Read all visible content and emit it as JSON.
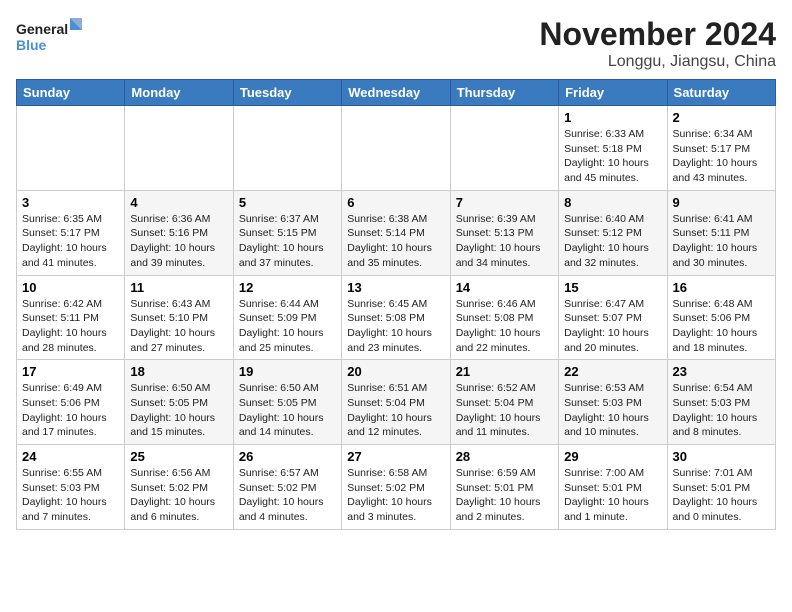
{
  "logo": {
    "line1": "General",
    "line2": "Blue"
  },
  "title": "November 2024",
  "location": "Longgu, Jiangsu, China",
  "days_header": [
    "Sunday",
    "Monday",
    "Tuesday",
    "Wednesday",
    "Thursday",
    "Friday",
    "Saturday"
  ],
  "weeks": [
    [
      {
        "day": "",
        "info": ""
      },
      {
        "day": "",
        "info": ""
      },
      {
        "day": "",
        "info": ""
      },
      {
        "day": "",
        "info": ""
      },
      {
        "day": "",
        "info": ""
      },
      {
        "day": "1",
        "info": "Sunrise: 6:33 AM\nSunset: 5:18 PM\nDaylight: 10 hours\nand 45 minutes."
      },
      {
        "day": "2",
        "info": "Sunrise: 6:34 AM\nSunset: 5:17 PM\nDaylight: 10 hours\nand 43 minutes."
      }
    ],
    [
      {
        "day": "3",
        "info": "Sunrise: 6:35 AM\nSunset: 5:17 PM\nDaylight: 10 hours\nand 41 minutes."
      },
      {
        "day": "4",
        "info": "Sunrise: 6:36 AM\nSunset: 5:16 PM\nDaylight: 10 hours\nand 39 minutes."
      },
      {
        "day": "5",
        "info": "Sunrise: 6:37 AM\nSunset: 5:15 PM\nDaylight: 10 hours\nand 37 minutes."
      },
      {
        "day": "6",
        "info": "Sunrise: 6:38 AM\nSunset: 5:14 PM\nDaylight: 10 hours\nand 35 minutes."
      },
      {
        "day": "7",
        "info": "Sunrise: 6:39 AM\nSunset: 5:13 PM\nDaylight: 10 hours\nand 34 minutes."
      },
      {
        "day": "8",
        "info": "Sunrise: 6:40 AM\nSunset: 5:12 PM\nDaylight: 10 hours\nand 32 minutes."
      },
      {
        "day": "9",
        "info": "Sunrise: 6:41 AM\nSunset: 5:11 PM\nDaylight: 10 hours\nand 30 minutes."
      }
    ],
    [
      {
        "day": "10",
        "info": "Sunrise: 6:42 AM\nSunset: 5:11 PM\nDaylight: 10 hours\nand 28 minutes."
      },
      {
        "day": "11",
        "info": "Sunrise: 6:43 AM\nSunset: 5:10 PM\nDaylight: 10 hours\nand 27 minutes."
      },
      {
        "day": "12",
        "info": "Sunrise: 6:44 AM\nSunset: 5:09 PM\nDaylight: 10 hours\nand 25 minutes."
      },
      {
        "day": "13",
        "info": "Sunrise: 6:45 AM\nSunset: 5:08 PM\nDaylight: 10 hours\nand 23 minutes."
      },
      {
        "day": "14",
        "info": "Sunrise: 6:46 AM\nSunset: 5:08 PM\nDaylight: 10 hours\nand 22 minutes."
      },
      {
        "day": "15",
        "info": "Sunrise: 6:47 AM\nSunset: 5:07 PM\nDaylight: 10 hours\nand 20 minutes."
      },
      {
        "day": "16",
        "info": "Sunrise: 6:48 AM\nSunset: 5:06 PM\nDaylight: 10 hours\nand 18 minutes."
      }
    ],
    [
      {
        "day": "17",
        "info": "Sunrise: 6:49 AM\nSunset: 5:06 PM\nDaylight: 10 hours\nand 17 minutes."
      },
      {
        "day": "18",
        "info": "Sunrise: 6:50 AM\nSunset: 5:05 PM\nDaylight: 10 hours\nand 15 minutes."
      },
      {
        "day": "19",
        "info": "Sunrise: 6:50 AM\nSunset: 5:05 PM\nDaylight: 10 hours\nand 14 minutes."
      },
      {
        "day": "20",
        "info": "Sunrise: 6:51 AM\nSunset: 5:04 PM\nDaylight: 10 hours\nand 12 minutes."
      },
      {
        "day": "21",
        "info": "Sunrise: 6:52 AM\nSunset: 5:04 PM\nDaylight: 10 hours\nand 11 minutes."
      },
      {
        "day": "22",
        "info": "Sunrise: 6:53 AM\nSunset: 5:03 PM\nDaylight: 10 hours\nand 10 minutes."
      },
      {
        "day": "23",
        "info": "Sunrise: 6:54 AM\nSunset: 5:03 PM\nDaylight: 10 hours\nand 8 minutes."
      }
    ],
    [
      {
        "day": "24",
        "info": "Sunrise: 6:55 AM\nSunset: 5:03 PM\nDaylight: 10 hours\nand 7 minutes."
      },
      {
        "day": "25",
        "info": "Sunrise: 6:56 AM\nSunset: 5:02 PM\nDaylight: 10 hours\nand 6 minutes."
      },
      {
        "day": "26",
        "info": "Sunrise: 6:57 AM\nSunset: 5:02 PM\nDaylight: 10 hours\nand 4 minutes."
      },
      {
        "day": "27",
        "info": "Sunrise: 6:58 AM\nSunset: 5:02 PM\nDaylight: 10 hours\nand 3 minutes."
      },
      {
        "day": "28",
        "info": "Sunrise: 6:59 AM\nSunset: 5:01 PM\nDaylight: 10 hours\nand 2 minutes."
      },
      {
        "day": "29",
        "info": "Sunrise: 7:00 AM\nSunset: 5:01 PM\nDaylight: 10 hours\nand 1 minute."
      },
      {
        "day": "30",
        "info": "Sunrise: 7:01 AM\nSunset: 5:01 PM\nDaylight: 10 hours\nand 0 minutes."
      }
    ]
  ]
}
